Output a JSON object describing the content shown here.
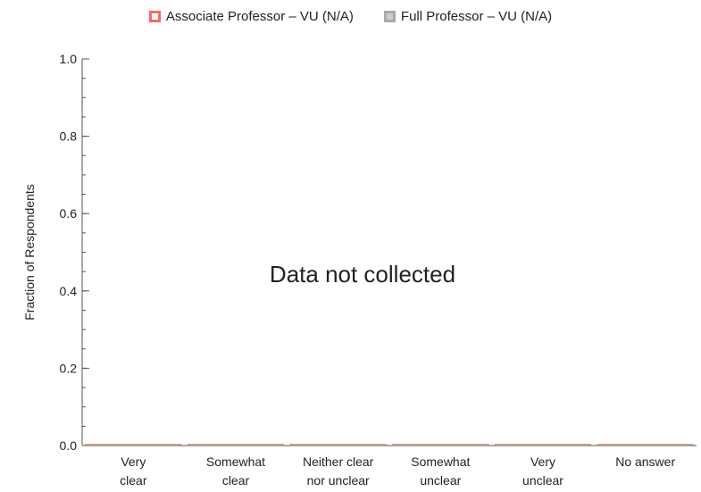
{
  "chart_data": {
    "type": "bar",
    "title": "",
    "ylabel": "Fraction of Respondents",
    "xlabel": "",
    "ylim": [
      0,
      1.0
    ],
    "yticks": [
      "0.0",
      "0.2",
      "0.4",
      "0.6",
      "0.8",
      "1.0"
    ],
    "categories": [
      [
        "Very",
        "clear"
      ],
      [
        "Somewhat",
        "clear"
      ],
      [
        "Neither clear",
        "nor unclear"
      ],
      [
        "Somewhat",
        "unclear"
      ],
      [
        "Very",
        "unclear"
      ],
      [
        "No answer"
      ]
    ],
    "series": [
      {
        "name": "Associate Professor – VU (N/A)",
        "color": "#f26b6b",
        "values": [
          0,
          0,
          0,
          0,
          0,
          0
        ]
      },
      {
        "name": "Full Professor – VU (N/A)",
        "color": "#aaaaaa",
        "values": [
          0,
          0,
          0,
          0,
          0,
          0
        ]
      }
    ],
    "annotation": "Data not collected",
    "grid": false,
    "legend_position": "top"
  }
}
